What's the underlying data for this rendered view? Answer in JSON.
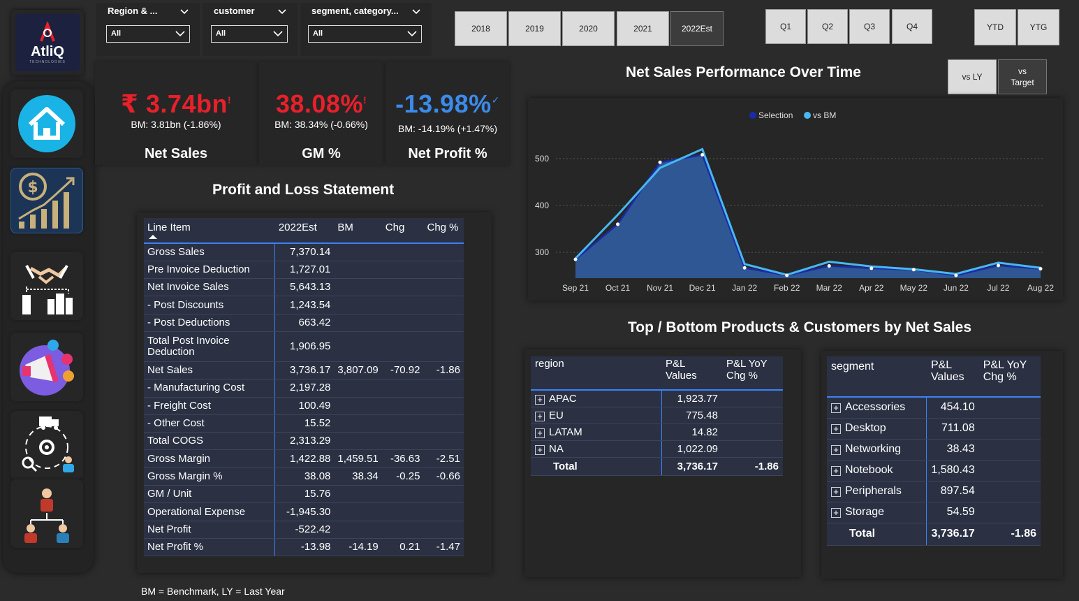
{
  "app": {
    "logo_text": "AtliQ",
    "logo_sub": "TECHNOLOGIES"
  },
  "sidebar": {
    "items": [
      {
        "name": "home"
      },
      {
        "name": "finance"
      },
      {
        "name": "sales"
      },
      {
        "name": "marketing"
      },
      {
        "name": "supply-chain"
      },
      {
        "name": "executive"
      }
    ]
  },
  "filters": {
    "region": {
      "label": "Region & ...",
      "value": "All"
    },
    "customer": {
      "label": "customer",
      "value": "All"
    },
    "segment": {
      "label": "segment, category...",
      "value": "All"
    }
  },
  "years": [
    "2018",
    "2019",
    "2020",
    "2021",
    "2022Est"
  ],
  "selected_year": "2022Est",
  "quarters": [
    "Q1",
    "Q2",
    "Q3",
    "Q4"
  ],
  "period": [
    "YTD",
    "YTG"
  ],
  "compare": {
    "vs_ly": "vs LY",
    "vs_target_1": "vs",
    "vs_target_2": "Target"
  },
  "kpis": {
    "net_sales": {
      "value": "₹ 3.74bn",
      "mark": "!",
      "bm": "BM: 3.81bn (-1.86%)",
      "name": "Net Sales",
      "color": "#e8202a"
    },
    "gm": {
      "value": "38.08%",
      "mark": "!",
      "bm": "BM: 38.34% (-0.66%)",
      "name": "GM %",
      "color": "#e8202a"
    },
    "np": {
      "value": "-13.98%",
      "mark": "✓",
      "bm": "BM: -14.19% (+1.47%)",
      "name": "Net Profit %",
      "color": "#3b8beb"
    }
  },
  "pl": {
    "title": "Profit and Loss Statement",
    "headers": [
      "Line Item",
      "2022Est",
      "BM",
      "Chg",
      "Chg %"
    ],
    "rows": [
      [
        "Gross Sales",
        "7,370.14",
        "",
        "",
        ""
      ],
      [
        "Pre Invoice Deduction",
        "1,727.01",
        "",
        "",
        ""
      ],
      [
        "Net Invoice Sales",
        "5,643.13",
        "",
        "",
        ""
      ],
      [
        " - Post Discounts",
        "1,243.54",
        "",
        "",
        ""
      ],
      [
        " - Post Deductions",
        "663.42",
        "",
        "",
        ""
      ],
      [
        "Total Post Invoice Deduction",
        "1,906.95",
        "",
        "",
        ""
      ],
      [
        "Net Sales",
        "3,736.17",
        "3,807.09",
        "-70.92",
        "-1.86"
      ],
      [
        " - Manufacturing Cost",
        "2,197.28",
        "",
        "",
        ""
      ],
      [
        " - Freight Cost",
        "100.49",
        "",
        "",
        ""
      ],
      [
        " - Other Cost",
        "15.52",
        "",
        "",
        ""
      ],
      [
        "Total COGS",
        "2,313.29",
        "",
        "",
        ""
      ],
      [
        "Gross Margin",
        "1,422.88",
        "1,459.51",
        "-36.63",
        "-2.51"
      ],
      [
        "Gross Margin %",
        "38.08",
        "38.34",
        "-0.25",
        "-0.66"
      ],
      [
        "GM / Unit",
        "15.76",
        "",
        "",
        ""
      ],
      [
        "Operational Expense",
        "-1,945.30",
        "",
        "",
        ""
      ],
      [
        "Net Profit",
        "-522.42",
        "",
        "",
        ""
      ],
      [
        "Net Profit %",
        "-13.98",
        "-14.19",
        "0.21",
        "-1.47"
      ]
    ]
  },
  "chart_title": "Net Sales Performance Over Time",
  "chart_data": {
    "type": "area",
    "categories": [
      "Sep 21",
      "Oct 21",
      "Nov 21",
      "Dec 21",
      "Jan 22",
      "Feb 22",
      "Mar 22",
      "Apr 22",
      "May 22",
      "Jun 22",
      "Jul 22",
      "Aug 22"
    ],
    "series": [
      {
        "name": "Selection",
        "values": [
          285,
          360,
          492,
          508,
          267,
          251,
          271,
          266,
          263,
          251,
          272,
          265
        ],
        "color": "#1a2aa8"
      },
      {
        "name": "vs BM",
        "values": [
          287,
          380,
          480,
          520,
          275,
          252,
          280,
          270,
          264,
          254,
          278,
          267
        ],
        "color": "#47b8f0"
      }
    ],
    "yticks": [
      300,
      400,
      500
    ],
    "ylim": [
      245,
      540
    ],
    "legend": "top-center"
  },
  "tb_title": "Top / Bottom Products & Customers by Net Sales",
  "region_table": {
    "headers": [
      "region",
      "P&L\nValues",
      "P&L YoY\nChg %"
    ],
    "rows": [
      [
        "APAC",
        "1,923.77",
        ""
      ],
      [
        "EU",
        "775.48",
        ""
      ],
      [
        "LATAM",
        "14.82",
        ""
      ],
      [
        "NA",
        "1,022.09",
        ""
      ]
    ],
    "total": [
      "Total",
      "3,736.17",
      "-1.86"
    ]
  },
  "segment_table": {
    "headers": [
      "segment",
      "P&L\nValues",
      "P&L YoY\nChg %"
    ],
    "rows": [
      [
        "Accessories",
        "454.10",
        ""
      ],
      [
        "Desktop",
        "711.08",
        ""
      ],
      [
        "Networking",
        "38.43",
        ""
      ],
      [
        "Notebook",
        "1,580.43",
        ""
      ],
      [
        "Peripherals",
        "897.54",
        ""
      ],
      [
        "Storage",
        "54.59",
        ""
      ]
    ],
    "total": [
      "Total",
      "3,736.17",
      "-1.86"
    ]
  },
  "footnote": "BM = Benchmark, LY = Last Year"
}
